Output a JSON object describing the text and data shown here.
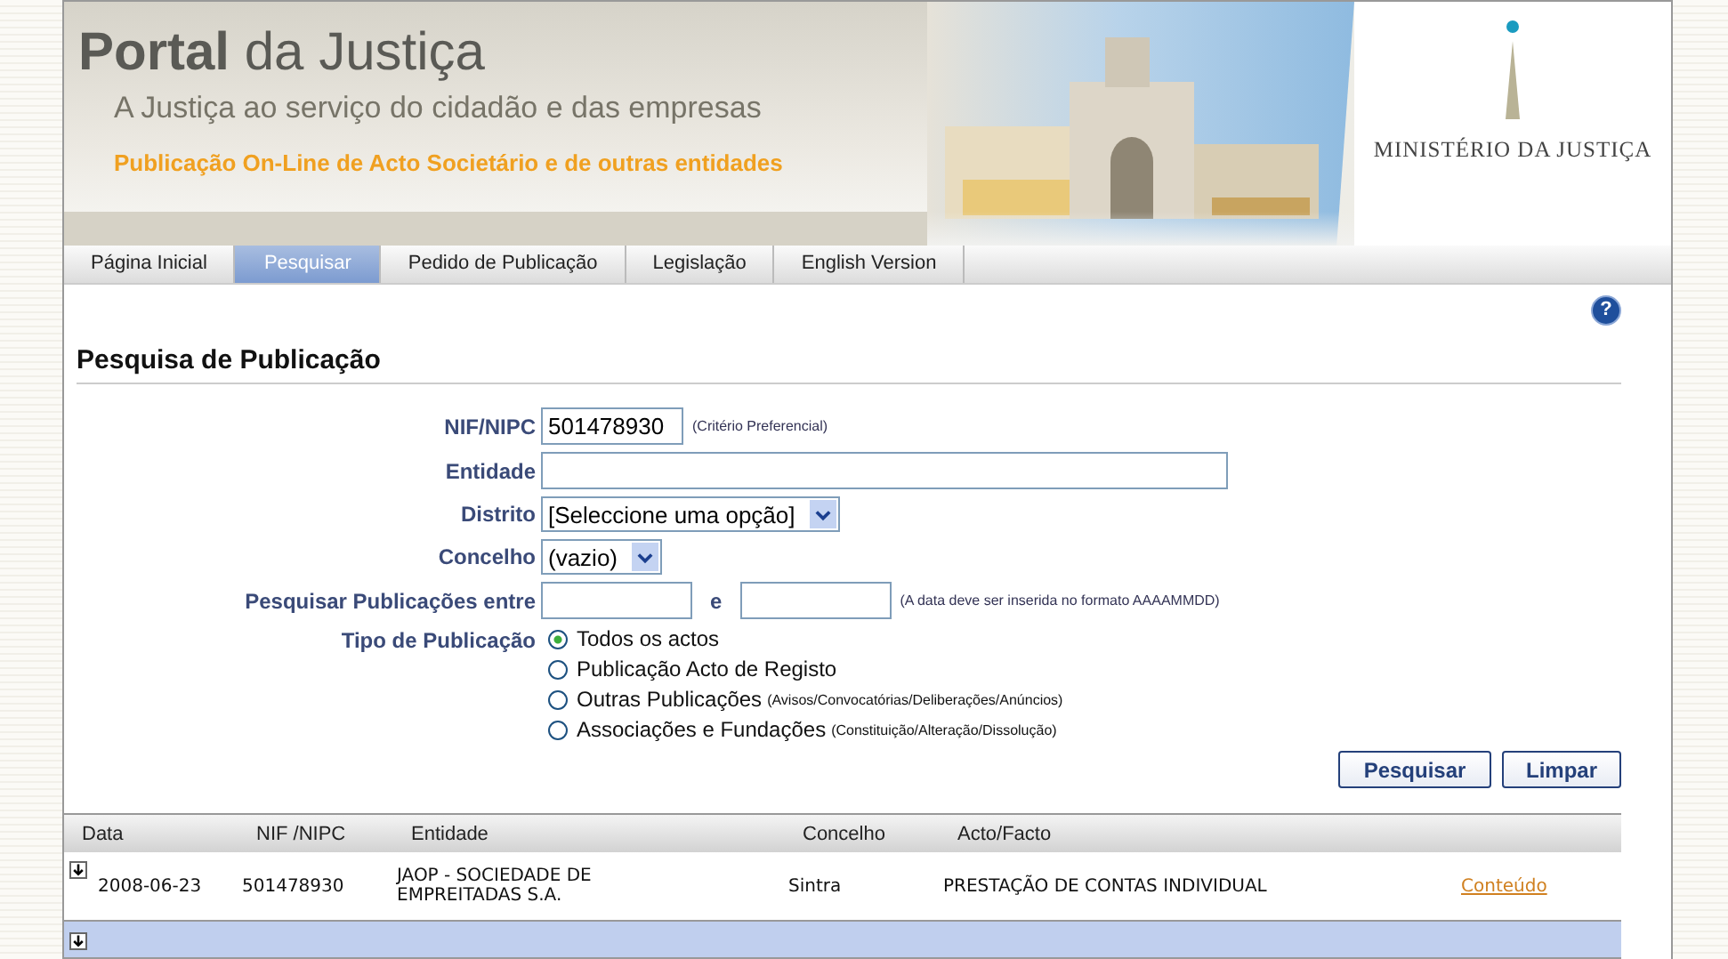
{
  "header": {
    "title": "**Portal** da Justiça",
    "subtitle": "A Justiça ao serviço do cidadão e das empresas",
    "service": "Publicação On-Line de Acto Societário e de outras entidades",
    "ministry": "MINISTÉRIO DA JUSTIÇA"
  },
  "tabs": [
    {
      "label": "Página Inicial",
      "selected": false
    },
    {
      "label": "Pesquisar",
      "selected": true
    },
    {
      "label": "Pedido de Publicação",
      "selected": false
    },
    {
      "label": "Legislação",
      "selected": false
    },
    {
      "label": "English Version",
      "selected": false
    }
  ],
  "help": "?",
  "form": {
    "heading": "Pesquisa de Publicação",
    "fields": [
      {
        "kind": "text",
        "label": "NIF/NIPC",
        "value": "501478930",
        "hint": "(Critério Preferencial)"
      },
      {
        "kind": "text-wide",
        "label": "Entidade"
      },
      {
        "kind": "select",
        "label": "Distrito",
        "value": "[Seleccione uma opção]"
      },
      {
        "kind": "select",
        "label": "Concelho",
        "value": "(vazio)"
      },
      {
        "kind": "date-range",
        "label": "Pesquisar Publicações entre",
        "separator": "e",
        "hint": "(A data deve ser inserida no formato AAAAMMDD)"
      },
      {
        "kind": "radio",
        "label": "Tipo de Publicação",
        "options": [
          {
            "label": "Todos os actos",
            "selected": true
          },
          {
            "label": "Publicação Acto de Registo",
            "selected": false
          },
          {
            "label": "Outras Publicações",
            "note": "(Avisos/Convocatórias/Deliberações/Anúncios)",
            "selected": false
          },
          {
            "label": "Associações e Fundações",
            "note": "(Constituição/Alteração/Dissolução)",
            "selected": false
          }
        ]
      }
    ],
    "buttons": [
      "Pesquisar",
      "Limpar"
    ]
  },
  "results": {
    "columns": [
      "Data",
      "NIF /NIPC",
      "Entidade",
      "Concelho",
      "Acto/Facto"
    ],
    "rows": [
      {
        "highlighted": false,
        "date": "2008-06-23",
        "nif": "501478930",
        "entity": "JAOP - SOCIEDADE DE EMPREITADAS S.A.",
        "concelho": "Sintra",
        "act": "PRESTAÇÃO DE CONTAS INDIVIDUAL",
        "link": "Conteúdo"
      },
      {
        "highlighted": true
      }
    ]
  }
}
